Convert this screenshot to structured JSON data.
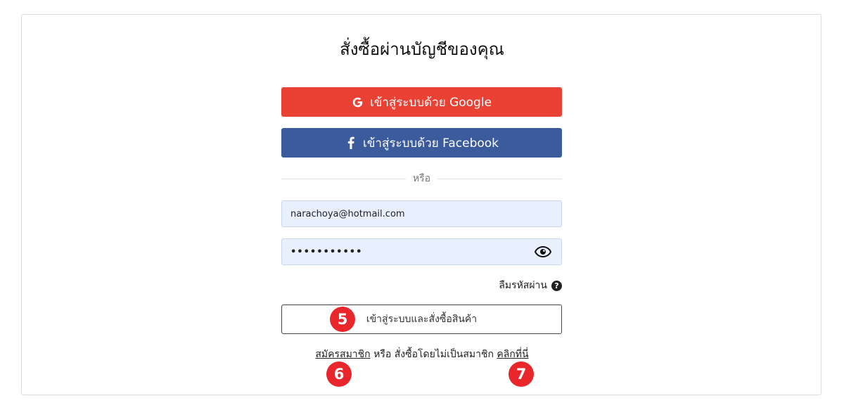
{
  "page": {
    "title": "สั่งซื้อผ่านบัญชีของคุณ"
  },
  "social": {
    "google_label": "เข้าสู่ระบบด้วย Google",
    "google_icon": "google-icon",
    "google_color": "#e94235",
    "facebook_label": "เข้าสู่ระบบด้วย Facebook",
    "facebook_icon": "facebook-icon",
    "facebook_color": "#3b5b9c"
  },
  "divider": {
    "label": "หรือ"
  },
  "form": {
    "email_value": "narachoya@hotmail.com",
    "password_masked": "•••••••••••",
    "password_toggle_icon": "eye-icon",
    "forgot_label": "ลืมรหัสผ่าน",
    "forgot_icon": "question-circle-icon",
    "input_background": "#e8f0fe",
    "login_button_label": "เข้าสู่ระบบและสั่งซื้อสินค้า"
  },
  "footer": {
    "register_link": "สมัครสมาชิก",
    "middle_text": " หรือ สั่งซื้อโดยไม่เป็นสมาชิก ",
    "guest_link": "คลิกที่นี่"
  },
  "annotations": {
    "marker_color": "#e8262c",
    "marker_login": "5",
    "marker_register": "6",
    "marker_guest": "7"
  }
}
